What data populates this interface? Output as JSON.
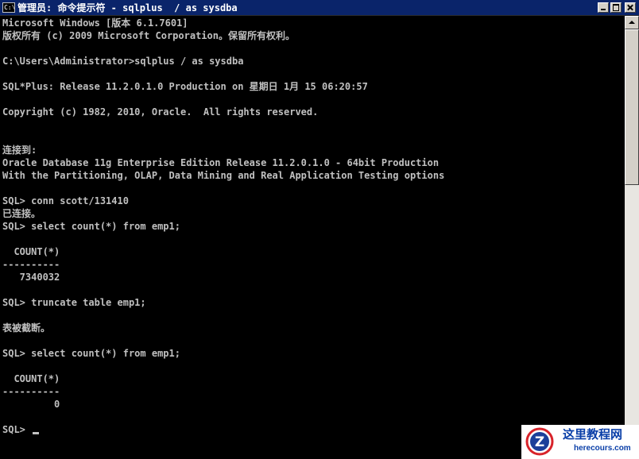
{
  "window": {
    "title": "管理员: 命令提示符 - sqlplus  / as sysdba",
    "icon_label": "C:\\",
    "icon": "cmd-icon"
  },
  "console": {
    "lines": [
      "Microsoft Windows [版本 6.1.7601]",
      "版权所有 (c) 2009 Microsoft Corporation。保留所有权利。",
      "",
      "C:\\Users\\Administrator>sqlplus / as sysdba",
      "",
      "SQL*Plus: Release 11.2.0.1.0 Production on 星期日 1月 15 06:20:57",
      "",
      "Copyright (c) 1982, 2010, Oracle.  All rights reserved.",
      "",
      "",
      "连接到:",
      "Oracle Database 11g Enterprise Edition Release 11.2.0.1.0 - 64bit Production",
      "With the Partitioning, OLAP, Data Mining and Real Application Testing options",
      "",
      "SQL> conn scott/131410",
      "已连接。",
      "SQL> select count(*) from emp1;",
      "",
      "  COUNT(*)",
      "----------",
      "   7340032",
      "",
      "SQL> truncate table emp1;",
      "",
      "表被截断。",
      "",
      "SQL> select count(*) from emp1;",
      "",
      "  COUNT(*)",
      "----------",
      "         0",
      "",
      "SQL> "
    ]
  },
  "watermark": {
    "name": "这里教程网",
    "url": "herecours.com",
    "logo_letter": "Z",
    "logo_icon": "z-logo-icon"
  },
  "colors": {
    "console_bg": "#000000",
    "console_fg": "#c0c0c0",
    "titlebar_bg": "#0a246a",
    "watermark_blue": "#0a3fa8",
    "logo_red": "#d8232a"
  }
}
